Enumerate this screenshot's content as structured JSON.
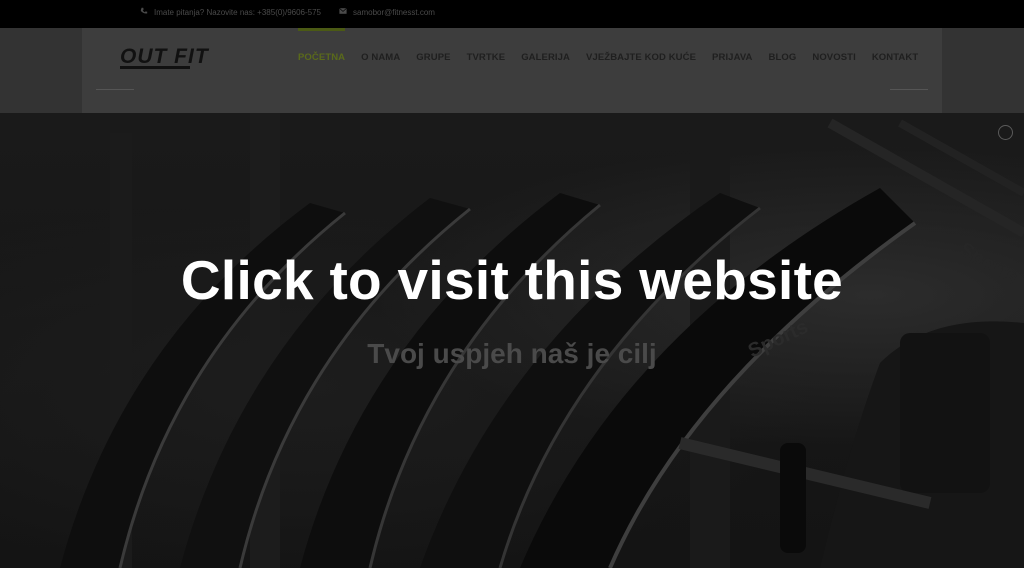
{
  "topbar": {
    "phone_text": "Imate pitanja? Nazovite nas: +385(0)/9606-575",
    "email_text": "samobor@fitnesst.com",
    "phone_icon": "phone-icon",
    "email_icon": "envelope-icon"
  },
  "header": {
    "logo_text": "OUT FIT",
    "nav": [
      {
        "label": "POČETNA",
        "active": true
      },
      {
        "label": "O NAMA"
      },
      {
        "label": "GRUPE"
      },
      {
        "label": "TVRTKE"
      },
      {
        "label": "GALERIJA"
      },
      {
        "label": "VJEŽBAJTE KOD KUĆE"
      },
      {
        "label": "PRIJAVA"
      },
      {
        "label": "BLOG"
      },
      {
        "label": "NOVOSTI"
      },
      {
        "label": "KONTAKT"
      }
    ]
  },
  "hero": {
    "tagline": "Tvoj uspjeh naš je cilj",
    "machine_brand_text": "Sports"
  },
  "overlay": {
    "cta_text": "Click to visit this website"
  },
  "colors": {
    "accent": "#4b5a14",
    "overlay": "#000000"
  }
}
